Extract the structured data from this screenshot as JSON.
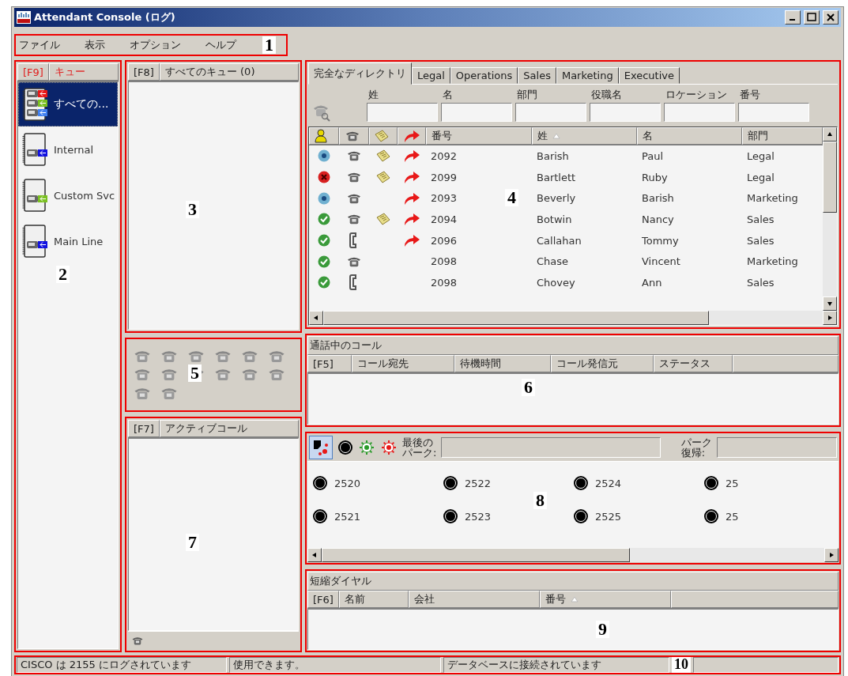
{
  "window": {
    "title": "Attendant Console (ログ)"
  },
  "menu": {
    "callout": "1",
    "items": [
      "ファイル",
      "表示",
      "オプション",
      "ヘルプ"
    ]
  },
  "queues": {
    "callout": "2",
    "header": [
      "[F9]",
      "キュー"
    ],
    "items": [
      {
        "label": "すべての...",
        "kind": "all",
        "selected": true
      },
      {
        "label": "Internal",
        "kind": "single",
        "color": "#1010e0",
        "selected": false
      },
      {
        "label": "Custom Svc",
        "kind": "single",
        "color": "#7ac020",
        "selected": false
      },
      {
        "label": "Main Line",
        "kind": "single",
        "color": "#1010e0",
        "selected": false
      }
    ]
  },
  "queue_calls": {
    "callout": "3",
    "header": [
      "[F8]",
      "すべてのキュー (0)"
    ]
  },
  "toolbar": {
    "callout": "5"
  },
  "active_calls": {
    "callout": "7",
    "header": [
      "[F7]",
      "アクティブコール"
    ]
  },
  "directory": {
    "callout": "4",
    "tabs": [
      {
        "label": "完全なディレクトリ",
        "selected": true
      },
      {
        "label": "Legal",
        "selected": false
      },
      {
        "label": "Operations",
        "selected": false
      },
      {
        "label": "Sales",
        "selected": false
      },
      {
        "label": "Marketing",
        "selected": false
      },
      {
        "label": "Executive",
        "selected": false
      }
    ],
    "filters": [
      "姓",
      "名",
      "部門",
      "役職名",
      "ロケーション",
      "番号"
    ],
    "columns": [
      {
        "label": "番号",
        "sorted": false
      },
      {
        "label": "姓",
        "sorted": true
      },
      {
        "label": "名",
        "sorted": false
      },
      {
        "label": "部門",
        "sorted": false
      }
    ],
    "rows": [
      {
        "status": {
          "kind": "idle"
        },
        "phone": {
          "kind": "desk"
        },
        "note": true,
        "forward": true,
        "number": "2092",
        "last": "Barish",
        "first": "Paul",
        "dept": "Legal"
      },
      {
        "status": {
          "kind": "busy"
        },
        "phone": {
          "kind": "desk"
        },
        "note": true,
        "forward": true,
        "number": "2099",
        "last": "Bartlett",
        "first": "Ruby",
        "dept": "Legal"
      },
      {
        "status": {
          "kind": "idle"
        },
        "phone": {
          "kind": "desk"
        },
        "note": false,
        "forward": true,
        "number": "2093",
        "last": "Beverly",
        "first": "Barish",
        "dept": "Marketing"
      },
      {
        "status": {
          "kind": "available"
        },
        "phone": {
          "kind": "desk"
        },
        "note": true,
        "forward": true,
        "number": "2094",
        "last": "Botwin",
        "first": "Nancy",
        "dept": "Sales"
      },
      {
        "status": {
          "kind": "available"
        },
        "phone": {
          "kind": "handset"
        },
        "note": false,
        "forward": true,
        "number": "2096",
        "last": "Callahan",
        "first": "Tommy",
        "dept": "Sales"
      },
      {
        "status": {
          "kind": "available"
        },
        "phone": {
          "kind": "desk"
        },
        "note": false,
        "forward": false,
        "number": "2098",
        "last": "Chase",
        "first": "Vincent",
        "dept": "Marketing"
      },
      {
        "status": {
          "kind": "available"
        },
        "phone": {
          "kind": "handset"
        },
        "note": false,
        "forward": false,
        "number": "2098",
        "last": "Chovey",
        "first": "Ann",
        "dept": "Sales"
      }
    ]
  },
  "calls_in_progress": {
    "callout": "6",
    "title": "通話中のコール",
    "columns": [
      "[F5]",
      "コール宛先",
      "待機時間",
      "コール発信元",
      "ステータス"
    ]
  },
  "park": {
    "callout": "8",
    "last_park_label": [
      "最後の",
      "パーク:"
    ],
    "retrieve_label": [
      "パーク",
      "復帰:"
    ],
    "slots": [
      "2520",
      "2522",
      "2524",
      "25",
      "2521",
      "2523",
      "2525",
      "25"
    ]
  },
  "speed_dial": {
    "callout": "9",
    "title": "短縮ダイヤル",
    "columns": [
      {
        "label": "[F6]",
        "sorted": false
      },
      {
        "label": "名前",
        "sorted": false
      },
      {
        "label": "会社",
        "sorted": false
      },
      {
        "label": "番号",
        "sorted": true
      }
    ]
  },
  "status_bar": {
    "callout": "10",
    "panes": [
      "CISCO は 2155 にログされています",
      "使用できます。",
      "データベースに接続されています"
    ]
  }
}
